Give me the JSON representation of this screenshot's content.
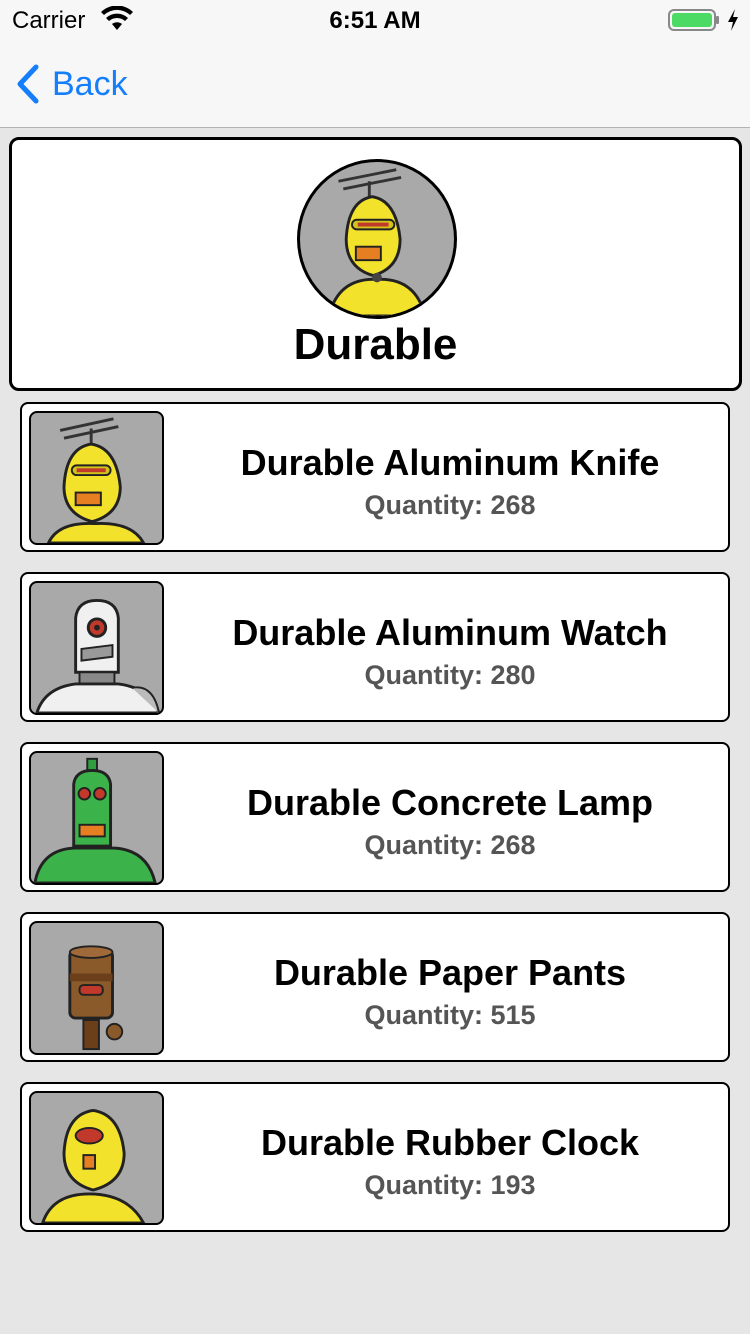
{
  "status_bar": {
    "carrier": "Carrier",
    "time": "6:51 AM",
    "battery_color": "#4cd964"
  },
  "nav": {
    "back_label": "Back",
    "back_color": "#147efb"
  },
  "header": {
    "title": "Durable",
    "avatar": "yellow-antenna-robot"
  },
  "items": [
    {
      "name": "Durable Aluminum Knife",
      "quantity": "Quantity: 268",
      "robot": "yellow-antenna-robot"
    },
    {
      "name": "Durable Aluminum Watch",
      "quantity": "Quantity: 280",
      "robot": "white-cyclops-robot"
    },
    {
      "name": "Durable Concrete Lamp",
      "quantity": "Quantity: 268",
      "robot": "green-robot"
    },
    {
      "name": "Durable Paper Pants",
      "quantity": "Quantity: 515",
      "robot": "brown-robot"
    },
    {
      "name": "Durable Rubber Clock",
      "quantity": "Quantity: 193",
      "robot": "yellow-one-eye-robot"
    }
  ]
}
